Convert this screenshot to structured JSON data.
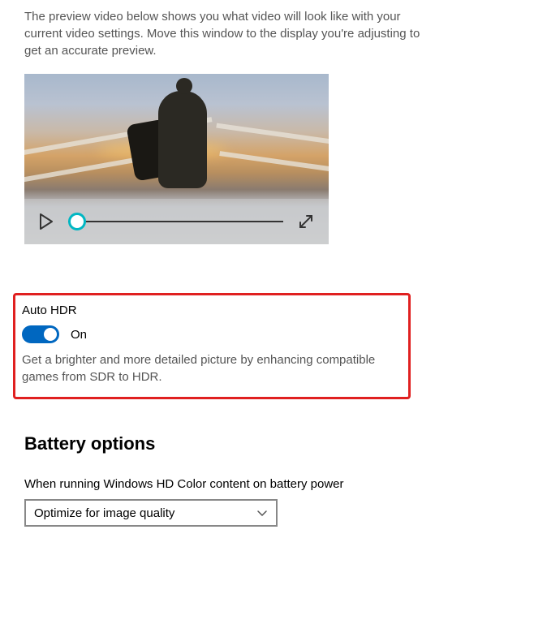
{
  "preview": {
    "description": "The preview video below shows you what video will look like with your current video settings. Move this window to the display you're adjusting to get an accurate preview."
  },
  "auto_hdr": {
    "title": "Auto HDR",
    "state_label": "On",
    "description": "Get a brighter and more detailed picture by enhancing compatible games from SDR to HDR."
  },
  "battery": {
    "heading": "Battery options",
    "field_label": "When running Windows HD Color content on battery power",
    "selected_option": "Optimize for image quality"
  },
  "icons": {
    "play": "play-icon",
    "fullscreen": "fullscreen-icon",
    "chevron": "chevron-down-icon"
  },
  "colors": {
    "accent": "#0067c0",
    "highlight": "#e02020",
    "scrub_accent": "#00b7c3"
  }
}
